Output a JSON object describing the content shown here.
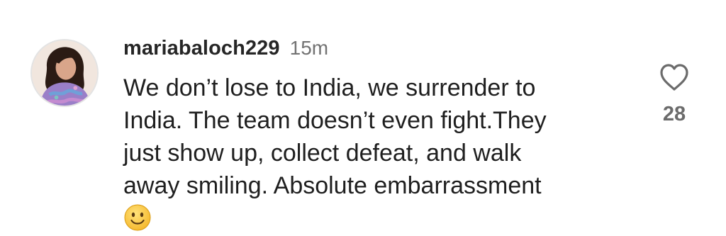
{
  "comment": {
    "username": "mariabaloch229",
    "timestamp": "15m",
    "text_lines": [
      "We don’t lose to India, we surrender to",
      "India. The team doesn’t even fight.They",
      "just show up, collect defeat, and walk",
      "away smiling. Absolute embarrassment"
    ],
    "emoji": "slightly-smiling-face",
    "like_count": "28",
    "like_icon": "heart-outline-icon"
  }
}
